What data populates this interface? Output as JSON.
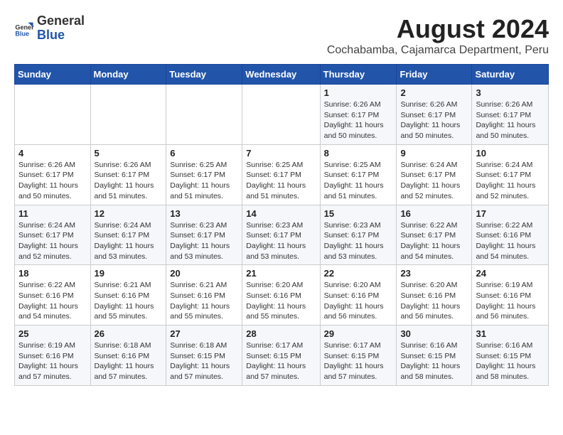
{
  "header": {
    "logo": {
      "general": "General",
      "blue": "Blue"
    },
    "title": "August 2024",
    "subtitle": "Cochabamba, Cajamarca Department, Peru"
  },
  "weekdays": [
    "Sunday",
    "Monday",
    "Tuesday",
    "Wednesday",
    "Thursday",
    "Friday",
    "Saturday"
  ],
  "weeks": [
    [
      {
        "day": "",
        "info": ""
      },
      {
        "day": "",
        "info": ""
      },
      {
        "day": "",
        "info": ""
      },
      {
        "day": "",
        "info": ""
      },
      {
        "day": "1",
        "info": "Sunrise: 6:26 AM\nSunset: 6:17 PM\nDaylight: 11 hours and 50 minutes."
      },
      {
        "day": "2",
        "info": "Sunrise: 6:26 AM\nSunset: 6:17 PM\nDaylight: 11 hours and 50 minutes."
      },
      {
        "day": "3",
        "info": "Sunrise: 6:26 AM\nSunset: 6:17 PM\nDaylight: 11 hours and 50 minutes."
      }
    ],
    [
      {
        "day": "4",
        "info": "Sunrise: 6:26 AM\nSunset: 6:17 PM\nDaylight: 11 hours and 50 minutes."
      },
      {
        "day": "5",
        "info": "Sunrise: 6:26 AM\nSunset: 6:17 PM\nDaylight: 11 hours and 51 minutes."
      },
      {
        "day": "6",
        "info": "Sunrise: 6:25 AM\nSunset: 6:17 PM\nDaylight: 11 hours and 51 minutes."
      },
      {
        "day": "7",
        "info": "Sunrise: 6:25 AM\nSunset: 6:17 PM\nDaylight: 11 hours and 51 minutes."
      },
      {
        "day": "8",
        "info": "Sunrise: 6:25 AM\nSunset: 6:17 PM\nDaylight: 11 hours and 51 minutes."
      },
      {
        "day": "9",
        "info": "Sunrise: 6:24 AM\nSunset: 6:17 PM\nDaylight: 11 hours and 52 minutes."
      },
      {
        "day": "10",
        "info": "Sunrise: 6:24 AM\nSunset: 6:17 PM\nDaylight: 11 hours and 52 minutes."
      }
    ],
    [
      {
        "day": "11",
        "info": "Sunrise: 6:24 AM\nSunset: 6:17 PM\nDaylight: 11 hours and 52 minutes."
      },
      {
        "day": "12",
        "info": "Sunrise: 6:24 AM\nSunset: 6:17 PM\nDaylight: 11 hours and 53 minutes."
      },
      {
        "day": "13",
        "info": "Sunrise: 6:23 AM\nSunset: 6:17 PM\nDaylight: 11 hours and 53 minutes."
      },
      {
        "day": "14",
        "info": "Sunrise: 6:23 AM\nSunset: 6:17 PM\nDaylight: 11 hours and 53 minutes."
      },
      {
        "day": "15",
        "info": "Sunrise: 6:23 AM\nSunset: 6:17 PM\nDaylight: 11 hours and 53 minutes."
      },
      {
        "day": "16",
        "info": "Sunrise: 6:22 AM\nSunset: 6:17 PM\nDaylight: 11 hours and 54 minutes."
      },
      {
        "day": "17",
        "info": "Sunrise: 6:22 AM\nSunset: 6:16 PM\nDaylight: 11 hours and 54 minutes."
      }
    ],
    [
      {
        "day": "18",
        "info": "Sunrise: 6:22 AM\nSunset: 6:16 PM\nDaylight: 11 hours and 54 minutes."
      },
      {
        "day": "19",
        "info": "Sunrise: 6:21 AM\nSunset: 6:16 PM\nDaylight: 11 hours and 55 minutes."
      },
      {
        "day": "20",
        "info": "Sunrise: 6:21 AM\nSunset: 6:16 PM\nDaylight: 11 hours and 55 minutes."
      },
      {
        "day": "21",
        "info": "Sunrise: 6:20 AM\nSunset: 6:16 PM\nDaylight: 11 hours and 55 minutes."
      },
      {
        "day": "22",
        "info": "Sunrise: 6:20 AM\nSunset: 6:16 PM\nDaylight: 11 hours and 56 minutes."
      },
      {
        "day": "23",
        "info": "Sunrise: 6:20 AM\nSunset: 6:16 PM\nDaylight: 11 hours and 56 minutes."
      },
      {
        "day": "24",
        "info": "Sunrise: 6:19 AM\nSunset: 6:16 PM\nDaylight: 11 hours and 56 minutes."
      }
    ],
    [
      {
        "day": "25",
        "info": "Sunrise: 6:19 AM\nSunset: 6:16 PM\nDaylight: 11 hours and 57 minutes."
      },
      {
        "day": "26",
        "info": "Sunrise: 6:18 AM\nSunset: 6:16 PM\nDaylight: 11 hours and 57 minutes."
      },
      {
        "day": "27",
        "info": "Sunrise: 6:18 AM\nSunset: 6:15 PM\nDaylight: 11 hours and 57 minutes."
      },
      {
        "day": "28",
        "info": "Sunrise: 6:17 AM\nSunset: 6:15 PM\nDaylight: 11 hours and 57 minutes."
      },
      {
        "day": "29",
        "info": "Sunrise: 6:17 AM\nSunset: 6:15 PM\nDaylight: 11 hours and 57 minutes."
      },
      {
        "day": "30",
        "info": "Sunrise: 6:16 AM\nSunset: 6:15 PM\nDaylight: 11 hours and 58 minutes."
      },
      {
        "day": "31",
        "info": "Sunrise: 6:16 AM\nSunset: 6:15 PM\nDaylight: 11 hours and 58 minutes."
      }
    ]
  ]
}
